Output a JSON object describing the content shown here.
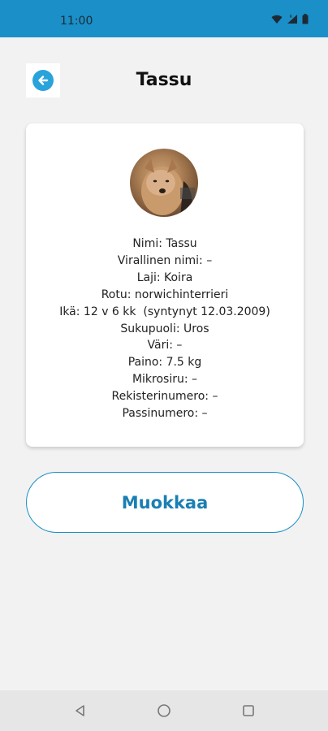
{
  "status_bar": {
    "time": "11:00"
  },
  "header": {
    "title": "Tassu"
  },
  "colors": {
    "accent": "#1a8fc8",
    "back_icon": "#2aa3db",
    "background": "#f2f2f2"
  },
  "pet_card": {
    "lines": [
      "Nimi: Tassu",
      "Virallinen nimi: –",
      "Laji: Koira",
      "Rotu: norwichinterrieri",
      "Ikä: 12 v 6 kk  (syntynyt 12.03.2009)",
      "Sukupuoli: Uros",
      "Väri: –",
      "Paino: 7.5 kg",
      "Mikrosiru: –",
      "Rekisterinumero: –",
      "Passinumero: –"
    ]
  },
  "actions": {
    "edit_label": "Muokkaa"
  },
  "icons": {
    "back": "arrow-left-icon",
    "wifi": "wifi-icon",
    "signal": "signal-icon",
    "battery": "battery-icon",
    "nav_back": "triangle-back-icon",
    "nav_home": "circle-home-icon",
    "nav_recents": "square-recents-icon"
  }
}
